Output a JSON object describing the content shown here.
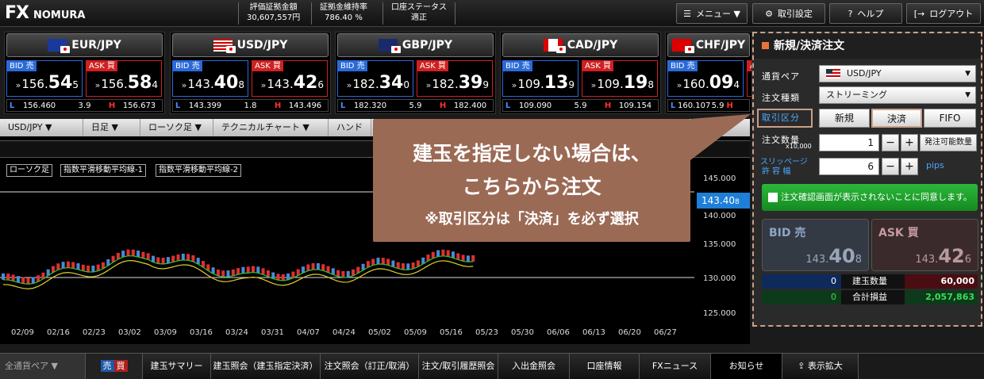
{
  "header": {
    "logo_fx": "FX",
    "logo_name": "NOMURA",
    "stats": [
      {
        "label": "評価証拠金額",
        "value": "30,607,557円"
      },
      {
        "label": "証拠金維持率",
        "value": "786.40 %"
      },
      {
        "label": "口座ステータス",
        "value": "適正"
      }
    ],
    "menu": "メニュー ▼",
    "settings": "取引設定",
    "help": "ヘルプ",
    "logout": "ログアウト"
  },
  "pairs": [
    {
      "name": "EUR/JPY",
      "bid": {
        "pre": "156.",
        "big": "54",
        "tail": "5"
      },
      "ask": {
        "pre": "156.",
        "big": "58",
        "tail": "4"
      },
      "low": "156.460",
      "spread": "3.9",
      "high": "156.673"
    },
    {
      "name": "USD/JPY",
      "bid": {
        "pre": "143.",
        "big": "40",
        "tail": "8"
      },
      "ask": {
        "pre": "143.",
        "big": "42",
        "tail": "6"
      },
      "low": "143.399",
      "spread": "1.8",
      "high": "143.496"
    },
    {
      "name": "GBP/JPY",
      "bid": {
        "pre": "182.",
        "big": "34",
        "tail": "0"
      },
      "ask": {
        "pre": "182.",
        "big": "39",
        "tail": "9"
      },
      "low": "182.320",
      "spread": "5.9",
      "high": "182.400"
    },
    {
      "name": "CAD/JPY",
      "bid": {
        "pre": "109.",
        "big": "13",
        "tail": "9"
      },
      "ask": {
        "pre": "109.",
        "big": "19",
        "tail": "8"
      },
      "low": "109.090",
      "spread": "5.9",
      "high": "109.154"
    },
    {
      "name": "CHF/JPY",
      "bid": {
        "pre": "160.",
        "big": "09",
        "tail": "4"
      },
      "ask": {
        "pre": "",
        "big": "",
        "tail": ""
      },
      "low": "160.107",
      "spread": "5.9",
      "high": ""
    }
  ],
  "labels": {
    "bid": "BID 売",
    "ask": "ASK 買",
    "low": "L",
    "high": "H"
  },
  "chart_toolbar": [
    "USD/JPY ▼",
    "日足 ▼",
    "ローソク足 ▼",
    "テクニカルチャート ▼",
    "ハンド"
  ],
  "chart_legend": [
    "ローソク足",
    "指数平滑移動平均線-1",
    "指数平滑移動平均線-2"
  ],
  "chart_yticks": [
    "145.000",
    "140.000",
    "135.000",
    "130.000",
    "125.000"
  ],
  "chart_xticks": [
    "02/09",
    "02/16",
    "02/23",
    "03/02",
    "03/09",
    "03/16",
    "03/24",
    "03/31",
    "04/07",
    "04/24",
    "05/02",
    "05/09",
    "05/16",
    "05/23",
    "05/30",
    "06/06",
    "06/13",
    "06/20",
    "06/27"
  ],
  "chart_price_tag": "143.40",
  "chart_price_tag_tail": "8",
  "callout": {
    "line1": "建玉を指定しない場合は、",
    "line2": "こちらから注文",
    "line3": "※取引区分は「決済」を必ず選択"
  },
  "order": {
    "title": "新規/決済注文",
    "pair_label": "通貨ペア",
    "pair_value": "USD/JPY",
    "type_label": "注文種類",
    "type_value": "ストリーミング",
    "kubun_label": "取引区分",
    "seg": [
      "新規",
      "決済",
      "FIFO"
    ],
    "qty_label": "注文数量",
    "qty_unit": "x10,000",
    "qty_value": "1",
    "qty_btn": "発注可能数量",
    "slip_label": "スリッページ",
    "slip_label2": "許 容 幅",
    "slip_value": "6",
    "slip_unit": "pips",
    "agree": "注文確認画面が表示されないことに同意します。",
    "bid_label": "BID 売",
    "bid_pre": "143.",
    "bid_big": "40",
    "bid_tail": "8",
    "ask_label": "ASK 買",
    "ask_pre": "143.",
    "ask_big": "42",
    "ask_tail": "6",
    "pos_left": "0",
    "pos_label": "建玉数量",
    "pos_value": "60,000",
    "pl_left": "0",
    "pl_label": "合計損益",
    "pl_value": "2,057,863"
  },
  "bottom": {
    "pair_select": "全通貨ペア",
    "sell": "売",
    "buy": "買",
    "tabs": [
      "建玉サマリー",
      "建玉照会（建玉指定決済）",
      "注文照会（訂正/取消）",
      "注文/取引履歴照会",
      "入出金照会",
      "口座情報",
      "FXニュース",
      "お知らせ",
      "表示拡大"
    ]
  }
}
